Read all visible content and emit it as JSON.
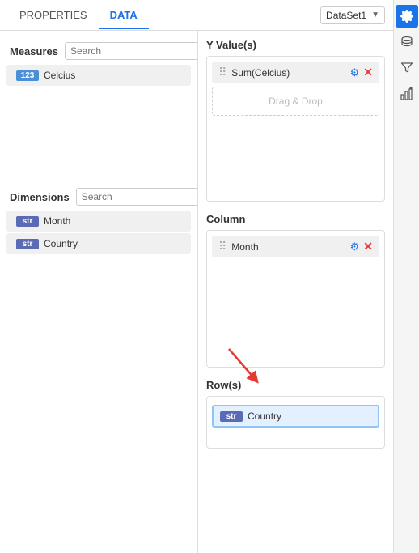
{
  "tabs": {
    "properties_label": "PROPERTIES",
    "data_label": "DATA",
    "active": "DATA"
  },
  "dataset": {
    "label": "DataSet1"
  },
  "left_panel": {
    "measures_title": "Measures",
    "measures_search_placeholder": "Search",
    "measures_fields": [
      {
        "id": "celcius",
        "badge": "123",
        "name": "Celcius"
      }
    ],
    "dimensions_title": "Dimensions",
    "dimensions_search_placeholder": "Search",
    "dimensions_fields": [
      {
        "id": "month",
        "badge": "str",
        "name": "Month"
      },
      {
        "id": "country",
        "badge": "str",
        "name": "Country"
      }
    ]
  },
  "right_panel": {
    "y_values_title": "Y Value(s)",
    "y_values_items": [
      {
        "id": "sum-celcius",
        "name": "Sum(Celcius)"
      }
    ],
    "drag_drop_placeholder": "Drag & Drop",
    "column_title": "Column",
    "column_items": [
      {
        "id": "month",
        "name": "Month"
      }
    ],
    "rows_title": "Row(s)",
    "rows_drop_item": {
      "id": "country",
      "badge": "str",
      "name": "Country"
    }
  },
  "sidebar": {
    "icons": [
      "gear",
      "database",
      "filter",
      "chart-settings"
    ]
  }
}
